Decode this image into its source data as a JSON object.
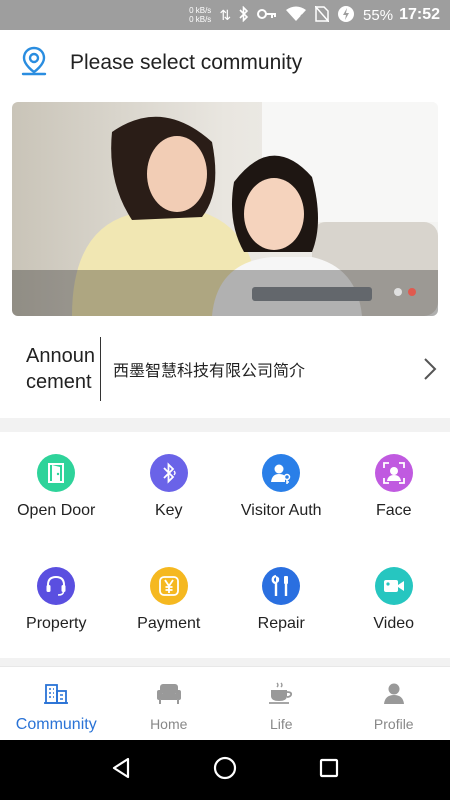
{
  "status_bar": {
    "speed_up": "0 kB/s",
    "speed_down": "0 kB/s",
    "battery_percent": "55%",
    "time": "17:52"
  },
  "header": {
    "title": "Please select community",
    "icon": "location-pin-icon"
  },
  "banner": {
    "description": "mother and daughter using a tablet",
    "slide_count": 2,
    "active_slide": 2,
    "dot_colors": {
      "inactive": "#e0e0e0",
      "active": "#e05a4f"
    }
  },
  "announcement": {
    "label": "Announcement",
    "text": "西墨智慧科技有限公司简介"
  },
  "services": [
    {
      "label": "Open Door",
      "icon": "door-icon",
      "color": "#2ed39a"
    },
    {
      "label": "Key",
      "icon": "bluetooth-icon",
      "color": "#6a63e8"
    },
    {
      "label": "Visitor Auth",
      "icon": "visitor-key-icon",
      "color": "#2a7fe8"
    },
    {
      "label": "Face",
      "icon": "face-scan-icon",
      "color": "#c05ae0"
    },
    {
      "label": "Property",
      "icon": "headset-icon",
      "color": "#5a4fe0"
    },
    {
      "label": "Payment",
      "icon": "yen-icon",
      "color": "#f5b820"
    },
    {
      "label": "Repair",
      "icon": "wrench-screwdriver-icon",
      "color": "#2a6fe0"
    },
    {
      "label": "Video",
      "icon": "video-camera-icon",
      "color": "#26c6c0"
    }
  ],
  "tabs": [
    {
      "label": "Community",
      "icon": "building-icon",
      "active": true
    },
    {
      "label": "Home",
      "icon": "sofa-icon",
      "active": false
    },
    {
      "label": "Life",
      "icon": "coffee-cup-icon",
      "active": false
    },
    {
      "label": "Profile",
      "icon": "person-icon",
      "active": false
    }
  ],
  "colors": {
    "accent": "#2a73d6",
    "status_bar": "#9e9e9e",
    "background": "#f2f2f2"
  }
}
